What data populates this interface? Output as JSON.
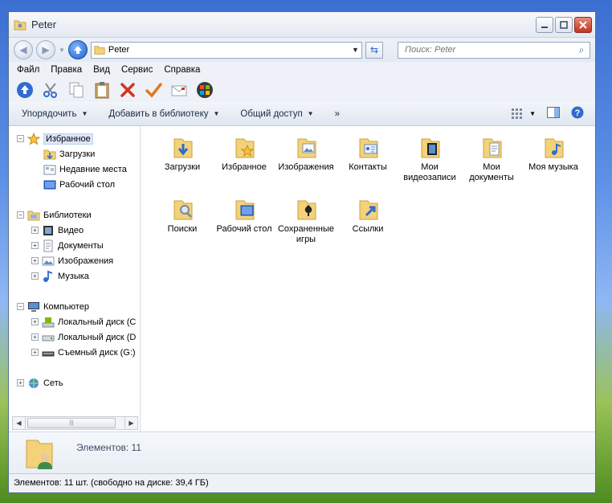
{
  "window": {
    "title": "Peter"
  },
  "address": {
    "path": "Peter",
    "search_placeholder": "Поиск: Peter"
  },
  "menu": [
    "Файл",
    "Правка",
    "Вид",
    "Сервис",
    "Справка"
  ],
  "commands": {
    "organize": "Упорядочить",
    "add_library": "Добавить в библиотеку",
    "share": "Общий доступ",
    "more": "»"
  },
  "nav": {
    "favorites": "Избранное",
    "downloads": "Загрузки",
    "recent": "Недавние места",
    "desktop": "Рабочий стол",
    "libraries": "Библиотеки",
    "video": "Видео",
    "documents": "Документы",
    "images": "Изображения",
    "music": "Музыка",
    "computer": "Компьютер",
    "local_c": "Локальный диск (C",
    "local_d": "Локальный диск (D",
    "removable": "Съемный диск (G:)",
    "network": "Сеть"
  },
  "items": [
    {
      "label": "Загрузки",
      "icon": "downloads-folder-icon"
    },
    {
      "label": "Избранное",
      "icon": "favorites-folder-icon"
    },
    {
      "label": "Изображения",
      "icon": "pictures-folder-icon"
    },
    {
      "label": "Контакты",
      "icon": "contacts-folder-icon"
    },
    {
      "label": "Мои видеозаписи",
      "icon": "videos-folder-icon"
    },
    {
      "label": "Мои документы",
      "icon": "documents-folder-icon"
    },
    {
      "label": "Моя музыка",
      "icon": "music-folder-icon"
    },
    {
      "label": "Поиски",
      "icon": "searches-folder-icon"
    },
    {
      "label": "Рабочий стол",
      "icon": "desktop-folder-icon"
    },
    {
      "label": "Сохраненные игры",
      "icon": "saved-games-folder-icon"
    },
    {
      "label": "Ссылки",
      "icon": "links-folder-icon"
    }
  ],
  "details": {
    "count": "Элементов: 11"
  },
  "status": {
    "text": "Элементов: 11 шт. (свободно на диске: 39,4 ГБ)"
  },
  "colors": {
    "folder": "#f3d27a",
    "accent": "#2f6bd0",
    "selection": "#dbe6f7"
  }
}
